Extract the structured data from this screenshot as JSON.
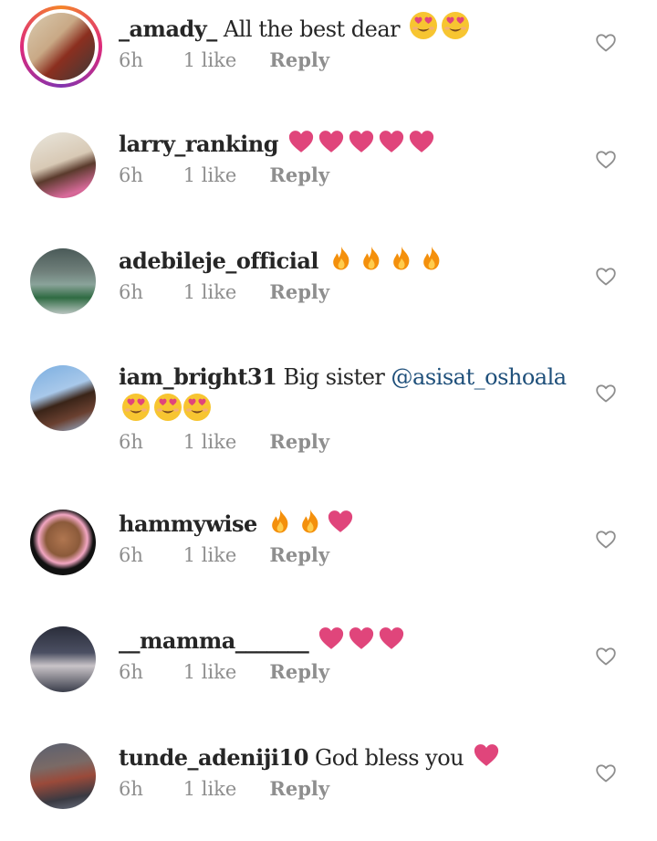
{
  "comments": [
    {
      "username": "_amady_",
      "text": "All the best dear",
      "emojis": [
        "smiling-face-with-heart-eyes",
        "smiling-face-with-heart-eyes"
      ],
      "time": "6h",
      "likes": "1 like",
      "reply": "Reply"
    },
    {
      "username": "larry_ranking",
      "text": "",
      "emojis": [
        "pink-heart",
        "pink-heart",
        "pink-heart",
        "pink-heart",
        "pink-heart"
      ],
      "time": "6h",
      "likes": "1 like",
      "reply": "Reply"
    },
    {
      "username": "adebileje_official",
      "text": "",
      "emojis": [
        "fire",
        "fire",
        "fire",
        "fire"
      ],
      "time": "6h",
      "likes": "1 like",
      "reply": "Reply"
    },
    {
      "username": "iam_bright31",
      "text": "Big sister",
      "mention": "@asisat_oshoala",
      "emojis": [
        "smiling-face-with-heart-eyes",
        "smiling-face-with-heart-eyes",
        "smiling-face-with-heart-eyes"
      ],
      "time": "6h",
      "likes": "1 like",
      "reply": "Reply"
    },
    {
      "username": "hammywise",
      "text": "",
      "emojis": [
        "fire",
        "fire",
        "pink-heart"
      ],
      "time": "6h",
      "likes": "1 like",
      "reply": "Reply"
    },
    {
      "username": "__mamma_______",
      "text": "",
      "emojis": [
        "pink-heart",
        "pink-heart",
        "pink-heart"
      ],
      "time": "6h",
      "likes": "1 like",
      "reply": "Reply"
    },
    {
      "username": "tunde_adeniji10",
      "text": "God bless you",
      "emojis": [
        "pink-heart"
      ],
      "time": "6h",
      "likes": "1 like",
      "reply": "Reply"
    }
  ],
  "colors": {
    "heart": "#e0457b",
    "fire": "#f4900c",
    "emoji_face": "#f7c531",
    "meta_text": "#8e8e8e",
    "mention": "#1e4f7a",
    "story_ring": "#dd2a7b"
  }
}
